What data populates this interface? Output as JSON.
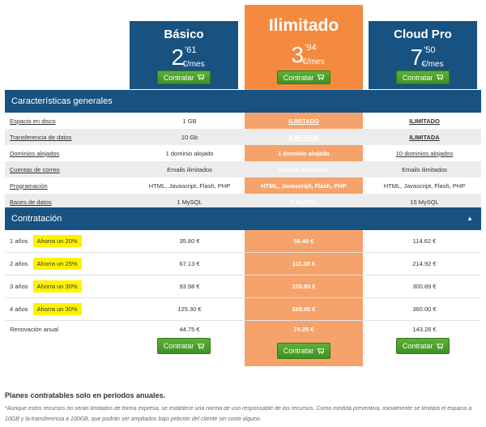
{
  "plans": [
    {
      "name": "Básico",
      "price_int": "2",
      "price_dec": "'61",
      "price_unit": "€/mes",
      "button": "Contratar",
      "color": "#175280"
    },
    {
      "name": "Ilimitado",
      "price_int": "3",
      "price_dec": "'94",
      "price_unit": "€/mes",
      "button": "Contratar",
      "color": "#f48a3f"
    },
    {
      "name": "Cloud Pro",
      "price_int": "7",
      "price_dec": "'50",
      "price_unit": "€/mes",
      "button": "Contratar",
      "color": "#175280"
    }
  ],
  "features": {
    "title": "Características generales",
    "rows": [
      {
        "label": "Espacio en disco",
        "v1": "1 GB",
        "v2": "ILIMITADO",
        "v3": "ILIMITADO"
      },
      {
        "label": "Transferencia de datos",
        "v1": "10 Gb",
        "v2": "ILIMITADA",
        "v3": "ILIMITADA"
      },
      {
        "label": "Dominios alojados",
        "v1": "1 dominio alojado",
        "v2": "1 dominio alojado",
        "v3": "10 dominios alojados"
      },
      {
        "label": "Cuentas de correo",
        "v1": "Emails ilimitados",
        "v2": "Emails ilimitados",
        "v3": "Emails ilimitados"
      },
      {
        "label": "Programación",
        "v1": "HTML, Javascript, Flash, PHP",
        "v2": "HTML, Javascript, Flash, PHP",
        "v3": "HTML, Javascript, Flash, PHP"
      },
      {
        "label": "Bases de datos",
        "v1": "1 MySQL",
        "v2": "5 MySQL",
        "v3": "15 MySQL"
      }
    ]
  },
  "contract": {
    "title": "Contratación",
    "rows": [
      {
        "label": "1 años",
        "badge": "Ahorra un 20%",
        "v1": "35.80 €",
        "v2": "59.40 €",
        "v3": "114.62 €"
      },
      {
        "label": "2 años",
        "badge": "Ahorra un 25%",
        "v1": "67.13 €",
        "v2": "111.38 €",
        "v3": "214.92 €"
      },
      {
        "label": "3 años",
        "badge": "Ahorra un 30%",
        "v1": "93.98 €",
        "v2": "155.93 €",
        "v3": "300.89 €"
      },
      {
        "label": "4 años",
        "badge": "Ahorra un 30%",
        "v1": "125.30 €",
        "v2": "189.00 €",
        "v3": "360.00 €"
      },
      {
        "label": "Renovación anual",
        "badge": "",
        "v1": "44.75 €",
        "v2": "74.25 €",
        "v3": "143.28 €"
      }
    ],
    "button": "Contratar"
  },
  "footer": {
    "heading": "Planes contratables solo en periodos anuales.",
    "note_line1": "*Aunque estos recursos no serán limitados de forma expresa, se establece una norma de uso responsable de los recursos. Como medida preventiva, inicialmente se limitará el espacio a",
    "note_line2": "10GB y la transferencia a 100GB, que podrán ser ampliados bajo petición del cliente sin coste alguno."
  },
  "colors": {
    "navy": "#175280",
    "orange": "#f48a3f",
    "orange_light": "#f6a36b",
    "green": "#4ca02c",
    "badge": "#fff200"
  }
}
